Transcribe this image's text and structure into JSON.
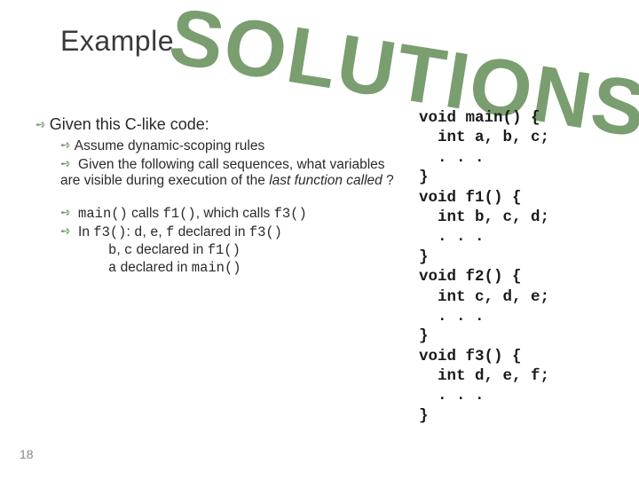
{
  "title": "Example",
  "watermark": "SOLUTIONS",
  "slide_number": "18",
  "bullets": {
    "lvl1": "Given this C-like code:",
    "sub1a": "Assume dynamic-scoping rules",
    "sub1b_prefix": "Given the following call sequences, what variables are visible during execution of the ",
    "sub1b_italic": "last function called",
    "sub1b_suffix": " ?",
    "sub2_t1": "main()",
    "sub2_plain1": " calls ",
    "sub2_t2": "f1()",
    "sub2_plain2": ", which calls ",
    "sub2_t3": "f3()",
    "sub3_plain1": "In ",
    "sub3_t1": "f3()",
    "sub3_plain2": ": ",
    "sub3_t2": "d",
    "sub3_plain3": ", ",
    "sub3_t3": "e",
    "sub3_plain4": ", ",
    "sub3_t4": "f",
    "sub3_plain5": " declared in ",
    "sub3_t5": "f3()",
    "line_b_1": "b",
    "line_b_2": ", ",
    "line_b_3": "c",
    "line_b_4": " declared in ",
    "line_b_5": "f1()",
    "line_c_1": "a",
    "line_c_2": " declared in ",
    "line_c_3": "main()"
  },
  "code": "void main() {\n  int a, b, c;\n  . . .\n}\nvoid f1() {\n  int b, c, d;\n  . . .\n}\nvoid f2() {\n  int c, d, e;\n  . . .\n}\nvoid f3() {\n  int d, e, f;\n  . . .\n}"
}
